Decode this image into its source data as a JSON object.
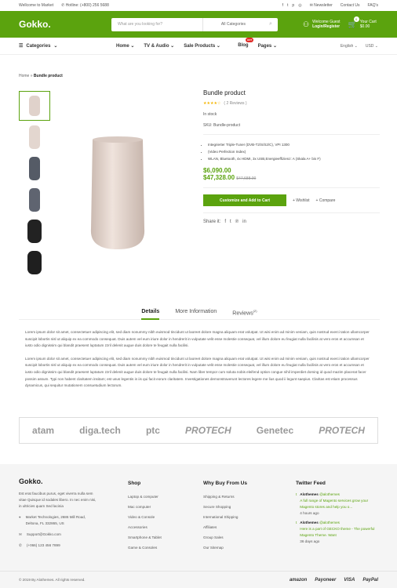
{
  "topbar": {
    "welcome": "Wellcome to Market",
    "hotline": "Hotline: (+800) 256 5688",
    "newsletter": "Newsletter",
    "contact": "Contact Us",
    "faq": "FAQ's"
  },
  "header": {
    "logo": "Gokko.",
    "search_placeholder": "What are you looking for?",
    "search_category": "All Categories",
    "welcome": "Welcome Guest",
    "login": "Login/Register",
    "cart_label": "Your Cart",
    "cart_total": "$0.00",
    "cart_count": "0"
  },
  "nav": {
    "categories": "Categories",
    "items": [
      "Home",
      "TV & Audio",
      "Sale Products",
      "Blog",
      "Pages"
    ],
    "hot": "HOT",
    "language": "English",
    "currency": "USD"
  },
  "breadcrumb": {
    "home": "Home",
    "current": "Bundle product"
  },
  "product": {
    "name": "Bundle product",
    "reviews": "( 2  Reviews )",
    "stock": "In stock",
    "sku": "SKU: Bundle-product",
    "features": [
      "Integrierter Triple-Tuner (DVB-T2/S/S2/C), VPI 1300",
      "(Video Perfection Index)",
      "WLAN, Bluetooth, 4x HDMI, 3x USB,Energieeffizienz: A (Skala A+ bis F)"
    ],
    "price": "$6,090.00",
    "price_range": "$47,328.00",
    "price_old": "$47,688.00",
    "add_to_cart": "Customize and Add to Cart",
    "wishlist": "+ Wishlist",
    "compare": "+ Compare",
    "share": "Share it:"
  },
  "tabs": {
    "details": "Details",
    "more": "More Information",
    "reviews": "Reviews",
    "reviews_count": "(2)"
  },
  "description": [
    "Lorem ipsum dolor sit amet, consectetuer adipiscing elit, sed diam nonummy nibh euismod tincidunt ut laoreet dolore magna aliquam erat volutpat. Ut wisi enim ad minim veniam, quis nostrud exerci tation ullamcorper suscipit lobortis nisl ut aliquip ex ea commodo consequat. Duis autem vel eum iriure dolor in hendrerit in vulputate velit esse molestie consequat, vel illum dolore eu feugiat nulla facilisis at vero eros et accumsan et iusto odio dignissim qui blandit praesent luptatum zzril delenit augue duis dolore te feugait nulla facilisi.",
    "Lorem ipsum dolor sit amet, consectetuer adipiscing elit, sed diam nonummy nibh euismod tincidunt ut laoreet dolore magna aliquam erat volutpat. Ut wisi enim ad minim veniam, quis nostrud exerci tation ullamcorper suscipit lobortis nisl ut aliquip ex ea commodo consequat. Duis autem vel eum iriure dolor in hendrerit in vulputate velit esse molestie consequat, vel illum dolore eu feugiat nulla facilisis at vero eros et accumsan et iusto odio dignissim qui blandit praesent luptatum zzril delenit augue duis dolore te feugait nulla facilisi. Nam liber tempor cum soluta nobis eleifend option congue nihil imperdiet doming id quod mazim placerat facer possim assum. Typi non habent claritatem insitam; est usus legentis in iis qui facit eorum claritatem. Investigationes demonstraverunt lectores legere me lius quod ii legunt saepius. Claritas est etiam processus dynamicus, qui sequitur mutationem consuetudium lectorum."
  ],
  "brands": [
    "atam",
    "diga.tech",
    "ptc",
    "PROTECH",
    "Genetec",
    "PROTECH"
  ],
  "footer": {
    "logo": "Gokko.",
    "about": "Est erat faucibus purus, eget viverra nulla sem vitae Quisque id sodales libero. In nec enim nisi, in ultricies quam Sed lacinia",
    "address": "Market Technologies, 2686 Mill Road, Deltona, FL 332865, US",
    "email": "Support@Gokko.com",
    "phone": "(+066) 123 456 7899",
    "shop_title": "Shop",
    "shop": [
      "Laptop & computer",
      "Mac computer",
      "Video & Console",
      "Accessories",
      "Smartphone & Tablet",
      "Game & Consoles"
    ],
    "why_title": "Why Buy From Us",
    "why": [
      "Shipping & Returns",
      "Secure Shopping",
      "International Shipping",
      "Affiliates",
      "Group Sales",
      "Our Sitemap"
    ],
    "twitter_title": "Twitter Feed",
    "tweets": [
      {
        "user": "Alothemes",
        "handle": "@alothemes",
        "text": "A full range of Magento services grow your Magento stores and help you o...",
        "time": "4 hours ago"
      },
      {
        "user": "Alothemes",
        "handle": "@alothemes",
        "text": "Here is a part of GECKO theme - The powerful Magento Theme. Want",
        "time": "36 days ago"
      }
    ],
    "copyright": "© 2019 By Alothemes. All rights reserved.",
    "payments": [
      "amazon",
      "Payoneer",
      "VISA",
      "PayPal"
    ]
  }
}
